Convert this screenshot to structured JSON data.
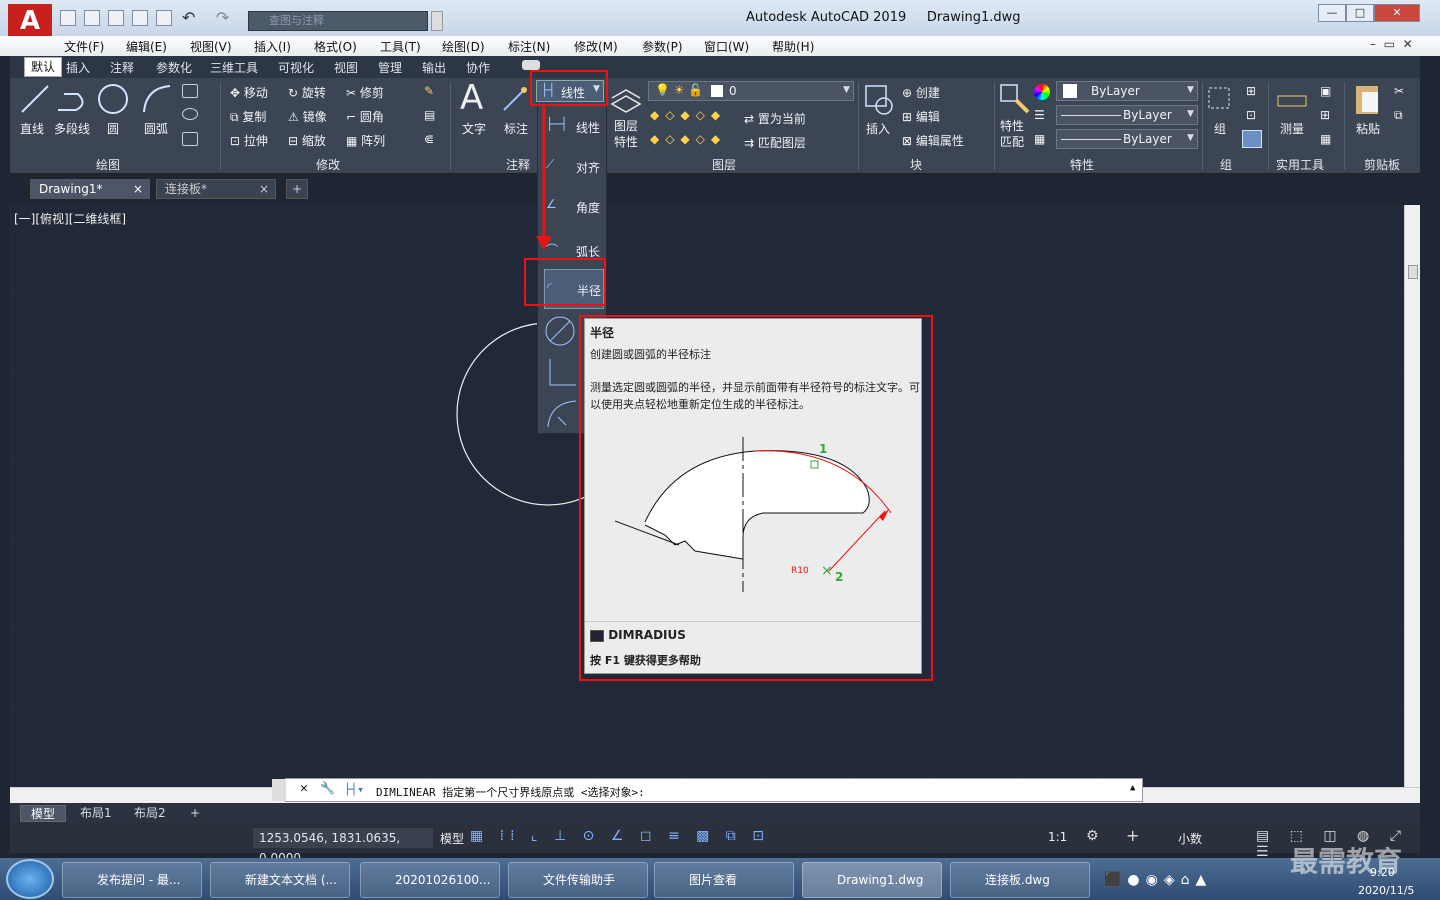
{
  "window": {
    "title": "Autodesk AutoCAD 2019",
    "document": "Drawing1.dwg",
    "search_placeholder": "查图与注释",
    "logo": "A"
  },
  "menus": [
    "文件(F)",
    "编辑(E)",
    "视图(V)",
    "插入(I)",
    "格式(O)",
    "工具(T)",
    "绘图(D)",
    "标注(N)",
    "修改(M)",
    "参数(P)",
    "窗口(W)",
    "帮助(H)"
  ],
  "ribbon_tabs": [
    "默认",
    "插入",
    "注释",
    "参数化",
    "三维工具",
    "可视化",
    "视图",
    "管理",
    "输出",
    "协作"
  ],
  "draw_panel": {
    "title": "绘图",
    "tools": [
      "直线",
      "多段线",
      "圆",
      "圆弧"
    ]
  },
  "modify_panel": {
    "title": "修改",
    "tools": [
      "移动",
      "旋转",
      "修剪",
      "复制",
      "镜像",
      "圆角",
      "拉伸",
      "缩放",
      "阵列"
    ]
  },
  "annotation_panel": {
    "title": "注释",
    "text": "文字",
    "dim": "标注",
    "linear": "线性"
  },
  "layers_panel": {
    "title": "图层",
    "props": "图层\n特性",
    "current_layer": "0",
    "set_current": "置为当前",
    "match_layer": "匹配图层"
  },
  "block_panel": {
    "title": "块",
    "insert": "插入",
    "create": "创建",
    "edit": "编辑",
    "edit_attr": "编辑属性"
  },
  "properties_panel": {
    "title": "特性",
    "match": "特性\n匹配",
    "color": "ByLayer",
    "linetype": "ByLayer",
    "lineweight": "ByLayer"
  },
  "groups_panel": {
    "title": "组",
    "label": "组"
  },
  "utilities_panel": {
    "title": "实用工具",
    "measure": "测量"
  },
  "clipboard_panel": {
    "title": "剪贴板",
    "paste": "粘贴"
  },
  "dropdown_items": [
    "线性",
    "对齐",
    "角度",
    "弧长",
    "半径"
  ],
  "doc_tabs": [
    "Drawing1*",
    "连接板*"
  ],
  "viewport_label": "[一][俯视][二维线框]",
  "tooltip": {
    "title": "半径",
    "summary": "创建圆或圆弧的半径标注",
    "description": "测量选定圆或圆弧的半径，并显示前面带有半径符号的标注文字。可以使用夹点轻松地重新定位生成的半径标注。",
    "command": "DIMRADIUS",
    "help": "按 F1 键获得更多帮助",
    "label1": "1",
    "label2": "2",
    "r_label": "R10"
  },
  "command_line": "DIMLINEAR 指定第一个尺寸界线原点或 <选择对象>:",
  "layout_tabs": [
    "模型",
    "布局1",
    "布局2"
  ],
  "status": {
    "coords": "1253.0546, 1831.0635, 0.0000",
    "model": "模型",
    "scale": "1:1",
    "units": "小数"
  },
  "taskbar": [
    "发布提问 - 最...",
    "新建文本文档 (...",
    "20201026100...",
    "文件传输助手",
    "图片查看",
    "Drawing1.dwg",
    "连接板.dwg"
  ],
  "clock": {
    "time": "9:20",
    "date": "2020/11/5"
  },
  "watermark": "最需教育",
  "colors": {
    "accent_red": "#e11111",
    "canvas": "#212938",
    "ribbon": "#3b4554"
  }
}
